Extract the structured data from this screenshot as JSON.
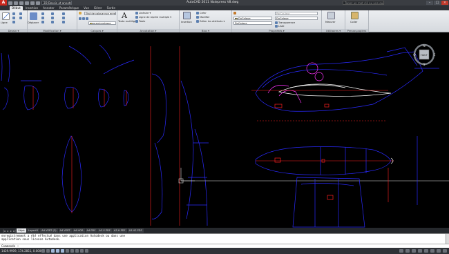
{
  "titlebar": {
    "workspace": "2D Dessin et annotation",
    "window_title": "AutoCAD 2011   Natepress V8.dwg",
    "help_placeholder": "Tapez un mot clé ou une question"
  },
  "ribbon_tabs": [
    "Début",
    "Insertion",
    "Annoter",
    "Paramétrique",
    "Vue",
    "Gérer",
    "Sortie"
  ],
  "ribbon": {
    "dessin": {
      "title": "Dessin ▾",
      "ligne": "Ligne"
    },
    "modification": {
      "title": "Modification ▾",
      "deplacer": "Déplacer"
    },
    "calques": {
      "title": "Calques ▾",
      "etat": "Etat de calque non enregistré",
      "layer_value": "premierplasse"
    },
    "annotation": {
      "title": "Annotation ▾",
      "texte": "Texte multiligne",
      "lineaire": "Linéaire ▾",
      "ligne_repere": "Ligne de repère multiple ▾",
      "table": "Table"
    },
    "bloc": {
      "title": "Bloc ▾",
      "insertion": "Insertion",
      "creer": "Créer",
      "modifier": "Modifier",
      "editer": "Editer les attributs ▾"
    },
    "proprietes": {
      "title": "Propriétés ▾",
      "couleur": "DuCalque",
      "epaisseur": "DuCalque",
      "type_ligne": "DuCalque",
      "par_couleur": "ParCouleur",
      "transparence": "Transparence",
      "liste": "Liste"
    },
    "utilitaires": {
      "title": "Utilitaires ▾",
      "mesurer": "Mesurer"
    },
    "presse_papiers": {
      "title": "Presse-papiers",
      "coller": "Coller"
    }
  },
  "viewcube": {
    "north": "N",
    "south": "S",
    "east": "E",
    "west": "O",
    "face": "HAUT"
  },
  "layout_tabs": [
    "Objet",
    "Layout1",
    "A4 VERT (2)",
    "A4 VERT",
    "A4 HOR",
    "A4 PDF",
    "A3 V PDF",
    "A3 H PDF",
    "A3 H2 PDF"
  ],
  "command": {
    "history": [
      "enregistrement a été effectué dans une application Autodesk ou dans une",
      "application sous licence Autodesk."
    ],
    "prompt": "Commande :"
  },
  "status": {
    "coords": "1429.9909, 174.2851, 0.0000"
  },
  "colors": {
    "background": "#000000",
    "drawing_blue": "#2a2aff",
    "drawing_red": "#ff2020",
    "drawing_white": "#ffffff",
    "drawing_magenta": "#ff33ff"
  }
}
